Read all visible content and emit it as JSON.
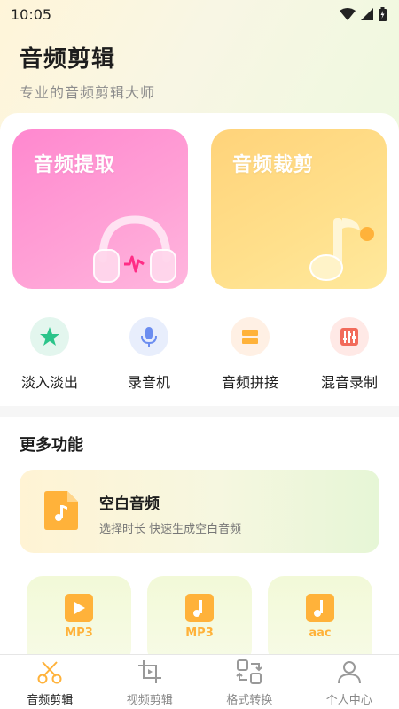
{
  "status_bar": {
    "time": "10:05"
  },
  "header": {
    "title": "音频剪辑",
    "subtitle": "专业的音频剪辑大师"
  },
  "feature_cards": [
    {
      "label": "音频提取",
      "icon": "headphones-icon",
      "color": "#ff8fd0"
    },
    {
      "label": "音频裁剪",
      "icon": "music-note-icon",
      "color": "#ffd77f"
    }
  ],
  "tools": [
    {
      "label": "淡入淡出",
      "icon": "star-icon",
      "bg": "#e3f6ee",
      "color": "#2bc48a"
    },
    {
      "label": "录音机",
      "icon": "microphone-icon",
      "bg": "#e8eefc",
      "color": "#6b8df0"
    },
    {
      "label": "音频拼接",
      "icon": "merge-icon",
      "bg": "#fff0e4",
      "color": "#ffb23a"
    },
    {
      "label": "混音录制",
      "icon": "mixer-icon",
      "bg": "#ffe9e6",
      "color": "#f26b5b"
    }
  ],
  "more": {
    "title": "更多功能",
    "blank_audio": {
      "title": "空白音频",
      "desc": "选择时长 快速生成空白音频"
    },
    "formats": [
      {
        "label": "MP3",
        "icon": "video-file-icon"
      },
      {
        "label": "MP3",
        "icon": "music-file-icon"
      },
      {
        "label": "aac",
        "icon": "music-file-icon"
      }
    ]
  },
  "bottom_nav": [
    {
      "label": "音频剪辑",
      "icon": "scissors-icon",
      "active": true
    },
    {
      "label": "视频剪辑",
      "icon": "video-crop-icon",
      "active": false
    },
    {
      "label": "格式转换",
      "icon": "convert-icon",
      "active": false
    },
    {
      "label": "个人中心",
      "icon": "person-icon",
      "active": false
    }
  ],
  "colors": {
    "accent": "#ffb23a",
    "pink": "#ff8fd0",
    "yellow": "#ffd77f",
    "nav_inactive": "#888888"
  }
}
